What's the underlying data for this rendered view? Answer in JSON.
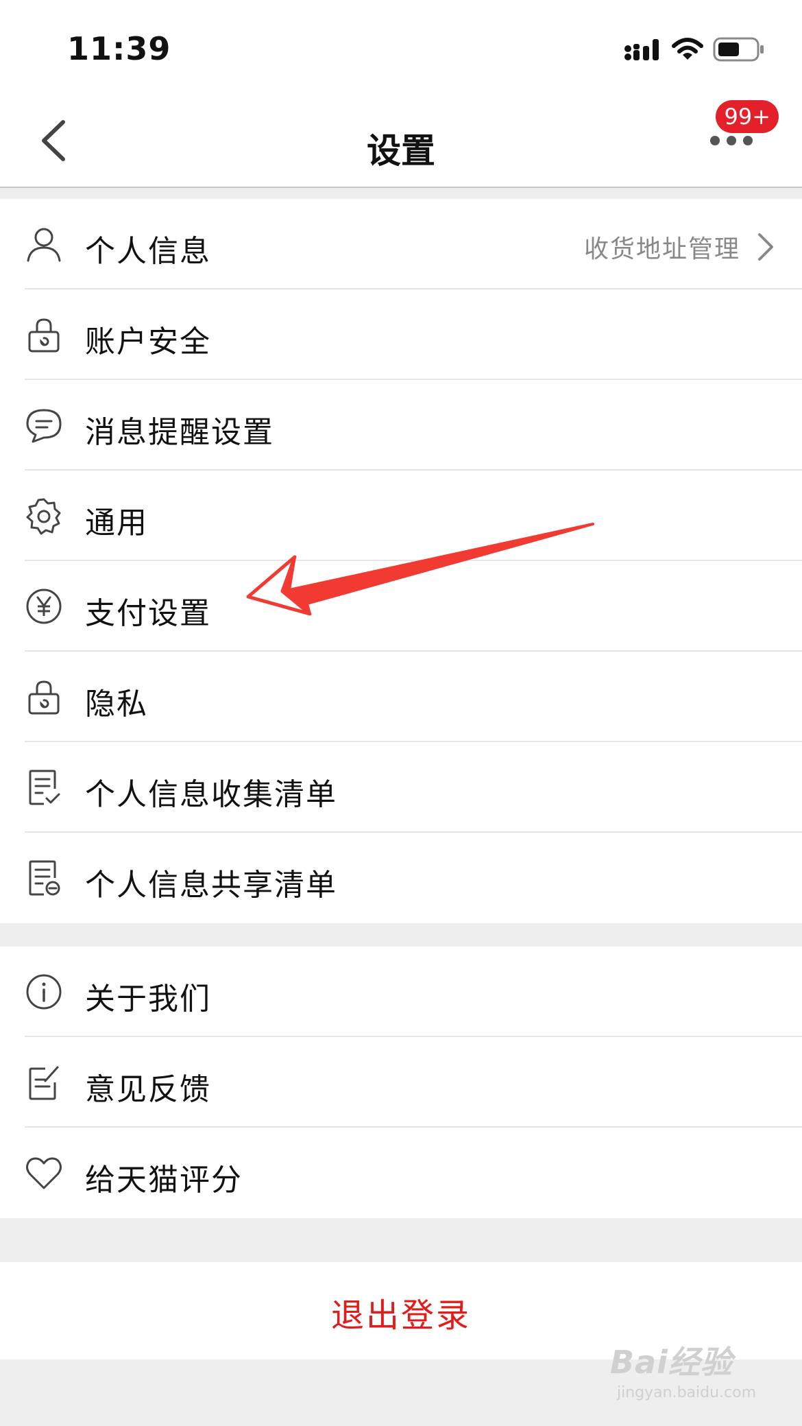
{
  "status_bar": {
    "time": "11:39"
  },
  "nav": {
    "title": "设置",
    "badge": "99+"
  },
  "group1": [
    {
      "label": "个人信息",
      "icon": "person-icon",
      "right_text": "收货地址管理"
    },
    {
      "label": "账户安全",
      "icon": "lock-icon"
    },
    {
      "label": "消息提醒设置",
      "icon": "message-icon"
    },
    {
      "label": "通用",
      "icon": "gear-icon"
    },
    {
      "label": "支付设置",
      "icon": "yuan-icon"
    },
    {
      "label": "隐私",
      "icon": "lock-icon"
    },
    {
      "label": "个人信息收集清单",
      "icon": "checklist-icon"
    },
    {
      "label": "个人信息共享清单",
      "icon": "shared-list-icon"
    }
  ],
  "group2": [
    {
      "label": "关于我们",
      "icon": "info-icon"
    },
    {
      "label": "意见反馈",
      "icon": "feedback-icon"
    },
    {
      "label": "给天猫评分",
      "icon": "heart-icon"
    }
  ],
  "logout": {
    "label": "退出登录"
  },
  "watermark": {
    "main": "Bai经验",
    "sub": "jingyan.baidu.com"
  },
  "colors": {
    "accent": "#e21b1b",
    "badge": "#e4202a",
    "annotation_arrow": "#f03a32"
  }
}
